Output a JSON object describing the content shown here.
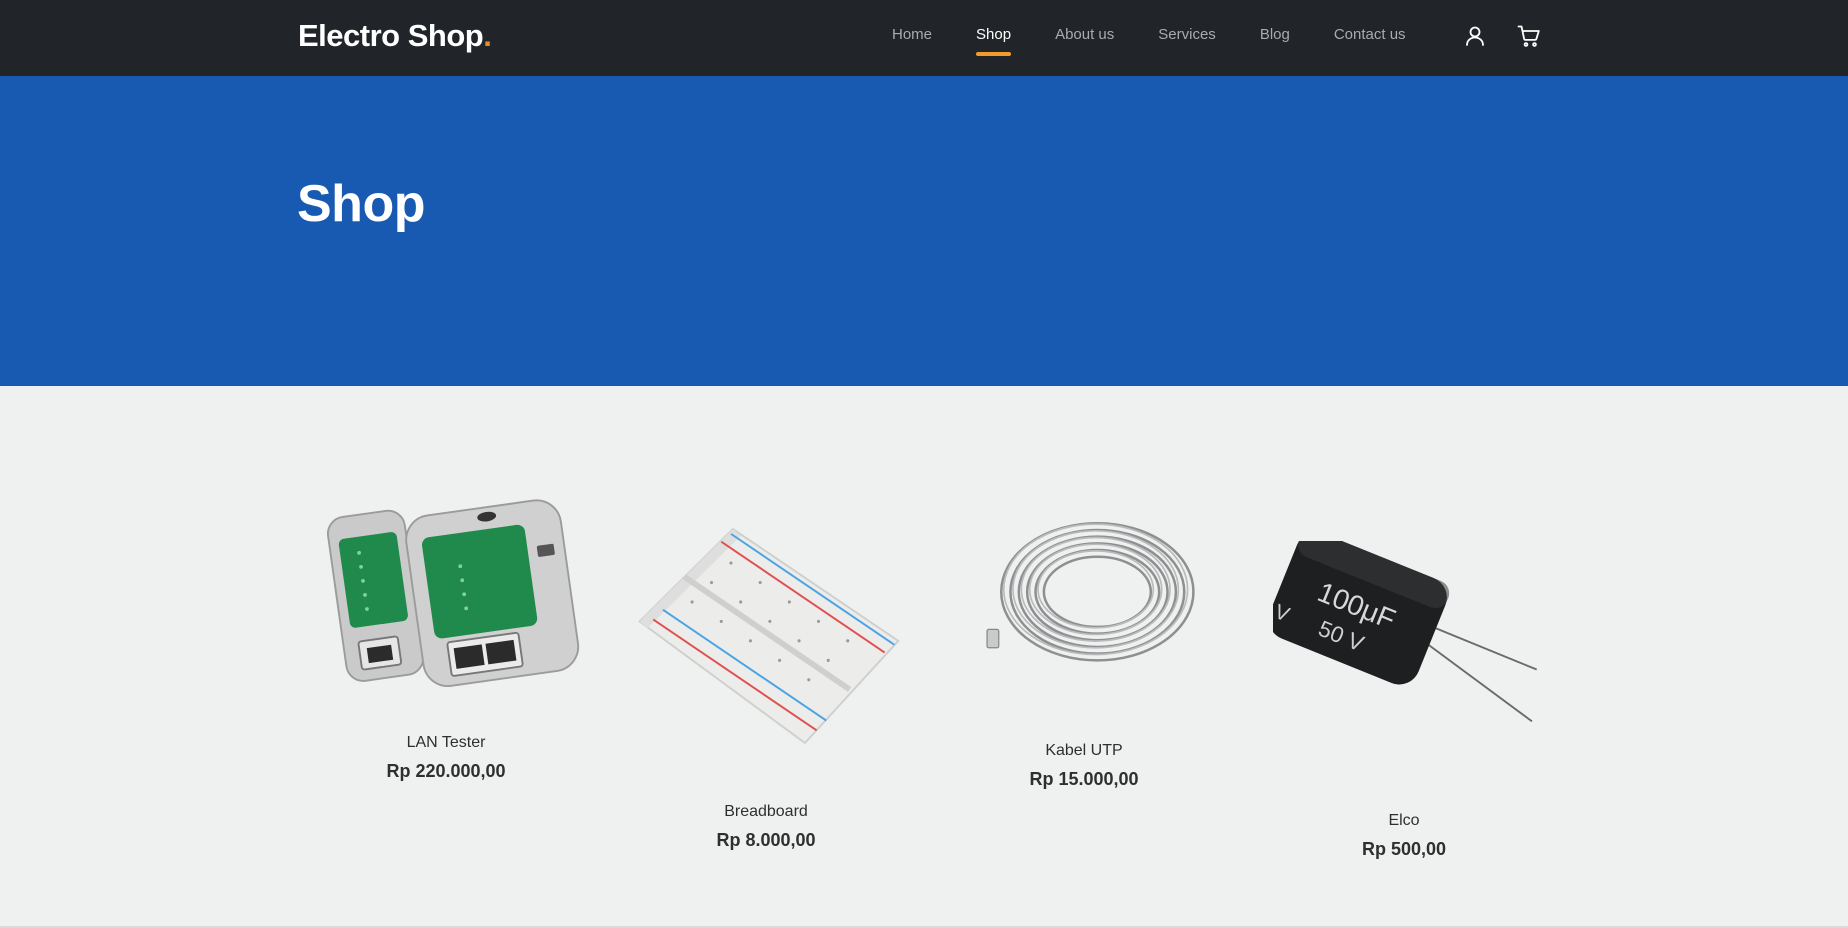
{
  "brand": {
    "name": "Electro Shop",
    "dot": "."
  },
  "nav": {
    "items": [
      {
        "label": "Home"
      },
      {
        "label": "Shop"
      },
      {
        "label": "About us"
      },
      {
        "label": "Services"
      },
      {
        "label": "Blog"
      },
      {
        "label": "Contact us"
      }
    ],
    "active": "Shop",
    "icons": [
      "user-icon",
      "cart-icon"
    ]
  },
  "hero": {
    "title": "Shop"
  },
  "products": [
    {
      "name": "LAN Tester",
      "price": "Rp 220.000,00"
    },
    {
      "name": "Breadboard",
      "price": "Rp 8.000,00"
    },
    {
      "name": "Kabel UTP",
      "price": "Rp 15.000,00"
    },
    {
      "name": "Elco",
      "price": "Rp 500,00"
    }
  ],
  "colors": {
    "navbar": "#212428",
    "hero": "#1859b1",
    "accent": "#f29b2d",
    "background": "#eff1f0"
  }
}
